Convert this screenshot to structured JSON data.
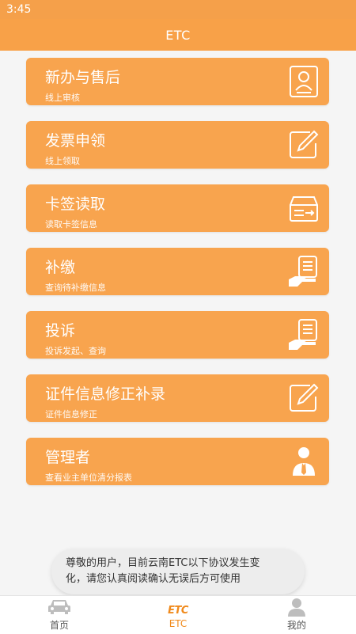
{
  "status_bar": {
    "time": "3:45"
  },
  "app_bar": {
    "title": "ETC"
  },
  "menu": [
    {
      "title": "新办与售后",
      "subtitle": "线上审核",
      "icon": "id-card-icon"
    },
    {
      "title": "发票申领",
      "subtitle": "线上领取",
      "icon": "edit-icon"
    },
    {
      "title": "卡签读取",
      "subtitle": "读取卡签信息",
      "icon": "card-reader-icon"
    },
    {
      "title": "补缴",
      "subtitle": "查询待补缴信息",
      "icon": "hand-document-icon"
    },
    {
      "title": "投诉",
      "subtitle": "投诉发起、查询",
      "icon": "hand-document-icon"
    },
    {
      "title": "证件信息修正补录",
      "subtitle": "证件信息修正",
      "icon": "edit-icon"
    },
    {
      "title": "管理者",
      "subtitle": "查看业主单位清分报表",
      "icon": "manager-icon"
    }
  ],
  "toast": {
    "line1": "尊敬的用户，目前云南ETC以下协议发生变",
    "line2": "化，请您认真阅读确认无误后方可使用"
  },
  "bottom_nav": [
    {
      "label": "首页",
      "icon": "car-icon"
    },
    {
      "label": "ETC",
      "icon": "etc-logo-icon",
      "logo_text": "ETC",
      "active": true
    },
    {
      "label": "我的",
      "icon": "user-icon"
    }
  ],
  "colors": {
    "accent": "#f8a148",
    "card": "#f8a44e",
    "active_nav": "#f08a1c"
  }
}
